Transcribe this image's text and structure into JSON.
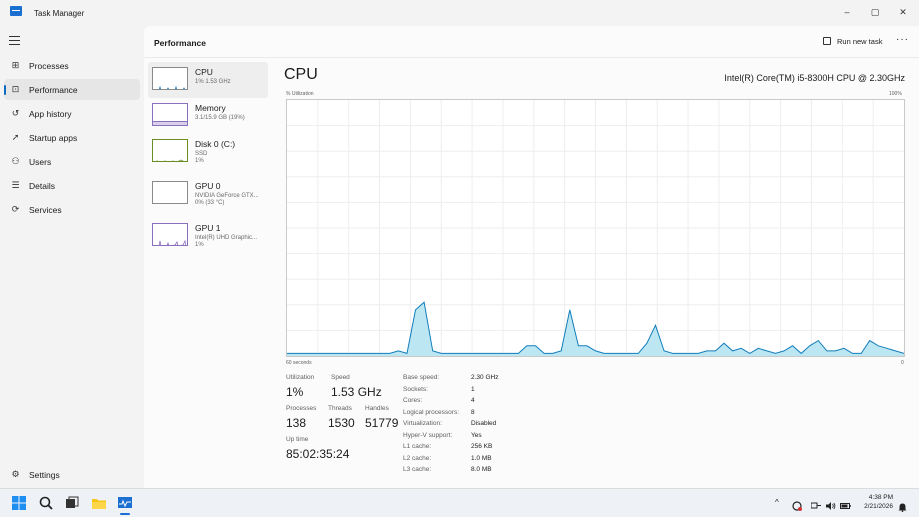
{
  "window": {
    "title": "Task Manager",
    "minimize": "–",
    "maximize": "▢",
    "close": "✕"
  },
  "nav": {
    "items": [
      {
        "label": "Processes",
        "icon": "processes-icon",
        "glyph": "⊞"
      },
      {
        "label": "Performance",
        "icon": "performance-icon",
        "glyph": "⊡",
        "active": true
      },
      {
        "label": "App history",
        "icon": "history-icon",
        "glyph": "↺"
      },
      {
        "label": "Startup apps",
        "icon": "startup-icon",
        "glyph": "➚"
      },
      {
        "label": "Users",
        "icon": "users-icon",
        "glyph": "⚇"
      },
      {
        "label": "Details",
        "icon": "details-icon",
        "glyph": "☰"
      },
      {
        "label": "Services",
        "icon": "services-icon",
        "glyph": "⟳"
      }
    ],
    "settings": {
      "label": "Settings",
      "icon": "gear-icon",
      "glyph": "⚙"
    }
  },
  "header": {
    "title": "Performance",
    "run_new_task": "Run new task",
    "more": "···"
  },
  "devices": [
    {
      "title": "CPU",
      "sub": "1% 1.53 GHz",
      "sub2": "",
      "active": true
    },
    {
      "title": "Memory",
      "sub": "3.1/15.9 GB (19%)",
      "sub2": ""
    },
    {
      "title": "Disk 0 (C:)",
      "sub": "SSD",
      "sub2": "1%"
    },
    {
      "title": "GPU 0",
      "sub": "NVIDIA GeForce GTX...",
      "sub2": "0% (33 °C)"
    },
    {
      "title": "GPU 1",
      "sub": "Intel(R) UHD Graphic...",
      "sub2": "1%"
    }
  ],
  "detail": {
    "title": "CPU",
    "model": "Intel(R) Core(TM) i5-8300H CPU @ 2.30GHz",
    "y_label": "% Utilization",
    "y_max": "100%",
    "x_left": "60 seconds",
    "x_right": "0",
    "graph_color": "#117dbb",
    "graph_fill": "#bde6f3",
    "utilization_series": [
      1,
      1,
      1,
      1,
      1,
      1,
      1,
      1,
      1,
      1,
      1,
      1,
      1,
      2,
      1,
      18,
      21,
      2,
      1,
      1,
      1,
      1,
      1,
      1,
      1,
      1,
      1,
      1,
      4,
      4,
      1,
      1,
      2,
      18,
      4,
      4,
      2,
      1,
      1,
      1,
      1,
      1,
      5,
      12,
      2,
      1,
      1,
      1,
      1,
      2,
      2,
      5,
      2,
      3,
      1,
      3,
      2,
      1,
      2,
      4,
      1,
      4,
      6,
      2,
      2,
      3,
      1,
      1,
      6,
      4,
      3,
      2,
      1
    ]
  },
  "stats": {
    "utilization_label": "Utilization",
    "utilization": "1%",
    "speed_label": "Speed",
    "speed": "1.53 GHz",
    "processes_label": "Processes",
    "processes": "138",
    "threads_label": "Threads",
    "threads": "1530",
    "handles_label": "Handles",
    "handles": "51779",
    "uptime_label": "Up time",
    "uptime": "85:02:35:24"
  },
  "specs": [
    {
      "label": "Base speed:",
      "value": "2.30 GHz"
    },
    {
      "label": "Sockets:",
      "value": "1"
    },
    {
      "label": "Cores:",
      "value": "4"
    },
    {
      "label": "Logical processors:",
      "value": "8"
    },
    {
      "label": "Virtualization:",
      "value": "Disabled"
    },
    {
      "label": "Hyper-V support:",
      "value": "Yes"
    },
    {
      "label": "L1 cache:",
      "value": "256 KB"
    },
    {
      "label": "L2 cache:",
      "value": "1.0 MB"
    },
    {
      "label": "L3 cache:",
      "value": "8.0 MB"
    }
  ],
  "taskbar": {
    "time": "4:38 PM",
    "date": "2/21/2026",
    "chevron": "^"
  }
}
